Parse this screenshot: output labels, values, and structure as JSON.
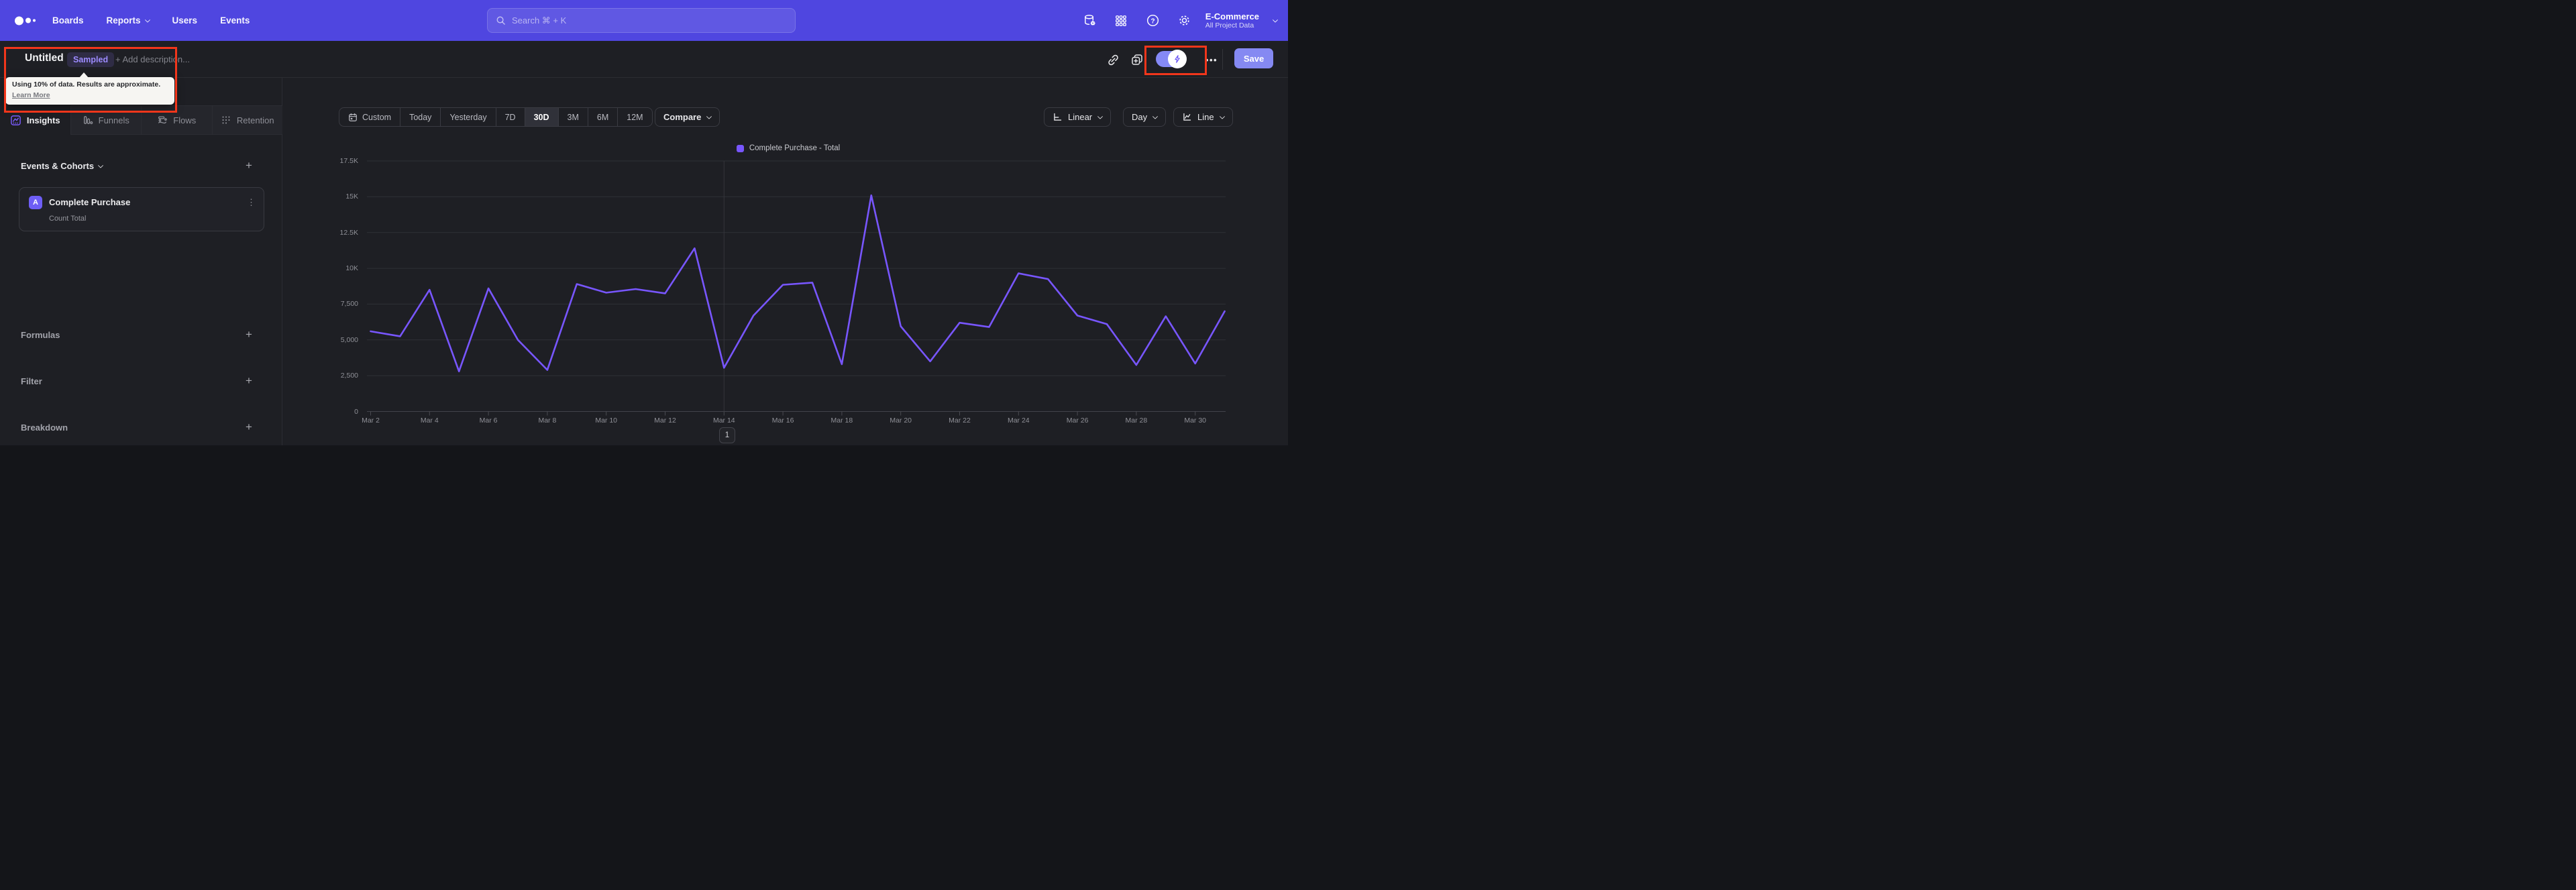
{
  "navbar": {
    "items": [
      {
        "label": "Boards",
        "chevron": false
      },
      {
        "label": "Reports",
        "chevron": true
      },
      {
        "label": "Users",
        "chevron": false
      },
      {
        "label": "Events",
        "chevron": false
      }
    ],
    "search": {
      "placeholder": "Search  ⌘ + K"
    },
    "project": {
      "name": "E-Commerce",
      "scope": "All Project Data"
    }
  },
  "report_header": {
    "title": "Untitled",
    "badge": "Sampled",
    "description_placeholder": "+ Add description...",
    "tooltip": {
      "text": "Using 10% of data. Results are approximate.",
      "link": "Learn More"
    },
    "save_label": "Save"
  },
  "sidebar": {
    "tabs": [
      {
        "label": "Insights",
        "active": true
      },
      {
        "label": "Funnels",
        "active": false
      },
      {
        "label": "Flows",
        "active": false
      },
      {
        "label": "Retention",
        "active": false
      }
    ],
    "events_section": {
      "label": "Events & Cohorts"
    },
    "event_card": {
      "letter": "A",
      "name": "Complete Purchase",
      "metric": "Count Total"
    },
    "sections": [
      {
        "label": "Formulas"
      },
      {
        "label": "Filter"
      },
      {
        "label": "Breakdown"
      }
    ]
  },
  "controls": {
    "date_ranges": [
      "Custom",
      "Today",
      "Yesterday",
      "7D",
      "30D",
      "3M",
      "6M",
      "12M"
    ],
    "active_range": "30D",
    "compare_label": "Compare",
    "scale_label": "Linear",
    "interval_label": "Day",
    "chart_type_label": "Line"
  },
  "chart_data": {
    "type": "line",
    "legend": "Complete Purchase - Total",
    "x": [
      "Mar 2",
      "Mar 3",
      "Mar 4",
      "Mar 5",
      "Mar 6",
      "Mar 7",
      "Mar 8",
      "Mar 9",
      "Mar 10",
      "Mar 11",
      "Mar 12",
      "Mar 13",
      "Mar 14",
      "Mar 15",
      "Mar 16",
      "Mar 17",
      "Mar 18",
      "Mar 19",
      "Mar 20",
      "Mar 21",
      "Mar 22",
      "Mar 23",
      "Mar 24",
      "Mar 25",
      "Mar 26",
      "Mar 27",
      "Mar 28",
      "Mar 29",
      "Mar 30",
      "Mar 31"
    ],
    "series": [
      {
        "name": "Complete Purchase - Total",
        "color": "#7856FF",
        "values": [
          5600,
          5250,
          8500,
          2800,
          8600,
          5000,
          2900,
          8900,
          8300,
          8550,
          8250,
          11400,
          3050,
          6700,
          8850,
          9000,
          3300,
          15100,
          5950,
          3500,
          6200,
          5900,
          9650,
          9250,
          6700,
          6100,
          3250,
          6650,
          3350,
          7000
        ]
      }
    ],
    "y_tick_labels_top_down": [
      "17.5K",
      "15K",
      "12.5K",
      "10K",
      "7,500",
      "5,000",
      "2,500",
      "0"
    ],
    "x_tick_labels": [
      "Mar 2",
      "Mar 4",
      "Mar 6",
      "Mar 8",
      "Mar 10",
      "Mar 12",
      "Mar 14",
      "Mar 16",
      "Mar 18",
      "Mar 20",
      "Mar 22",
      "Mar 24",
      "Mar 26",
      "Mar 28",
      "Mar 30"
    ],
    "ylim": [
      0,
      17500
    ],
    "grid": "horizontal",
    "legend_position": "top-center",
    "marker_x": "Mar 14"
  },
  "pagination": {
    "page": "1"
  },
  "colors": {
    "navbar": "#4F46E0",
    "accent_line": "#7856FF",
    "save_button": "#8589F2",
    "annotation_red": "#F2361B",
    "sampled_badge_text": "#9D8BFF"
  }
}
